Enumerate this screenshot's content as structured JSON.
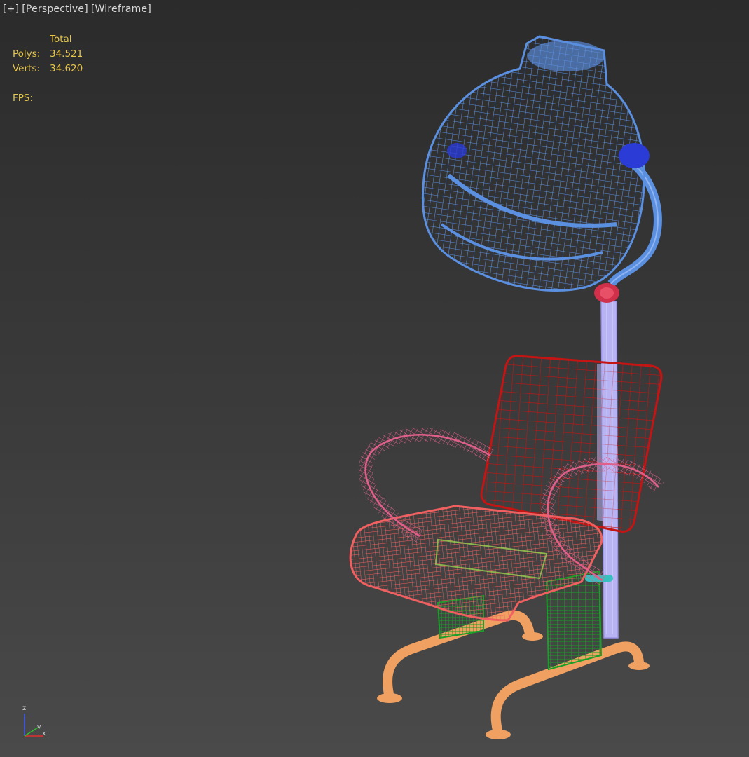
{
  "viewport": {
    "labels": [
      "[+]",
      "[Perspective]",
      "[Wireframe]"
    ]
  },
  "stats": {
    "header": "Total",
    "polys_label": "Polys:",
    "polys_value": "34.521",
    "verts_label": "Verts:",
    "verts_value": "34.620",
    "fps_label": "FPS:"
  },
  "axis_gizmo": {
    "z_label": "z",
    "y_label": "y",
    "x_label": "x"
  },
  "colors": {
    "hood": "#5b8fe0",
    "hood_knob": "#2a3bd6",
    "pole": "#b8b4f4",
    "pole_knob": "#d0304a",
    "backrest": "#c41414",
    "armrest": "#e0608a",
    "seat": "#f06060",
    "support": "#18a028",
    "base": "#f0a060",
    "stat_text": "#e6c74a"
  }
}
